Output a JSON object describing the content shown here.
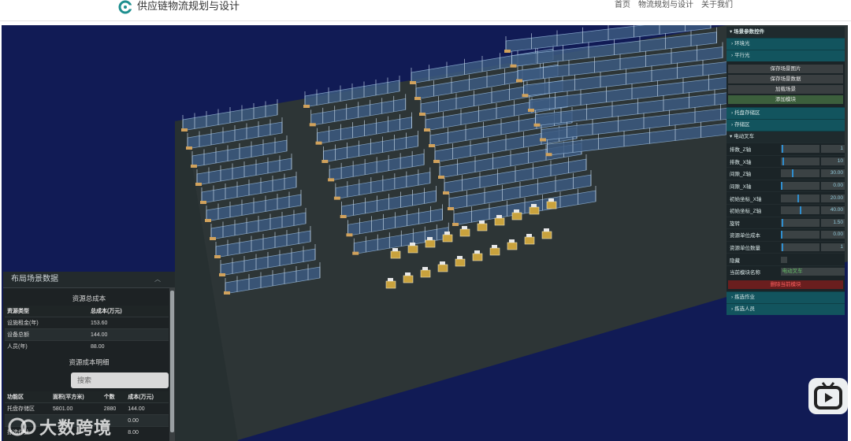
{
  "header": {
    "brand": "供应链物流规划与设计",
    "nav": [
      "首页",
      "物流规划与设计",
      "关于我们"
    ]
  },
  "control_panel": {
    "title": "场景参数控件",
    "top_sections": [
      "环境光",
      "平行光"
    ],
    "buttons": {
      "save_image": "保存场景图片",
      "save_data": "保存场景数据",
      "load_scene": "加载场景",
      "add_module": "添加模块"
    },
    "zones": [
      "托盘存储区",
      "存储区"
    ],
    "forklift": {
      "title": "电动叉车",
      "params": [
        {
          "label": "排数_Z轴",
          "value": "1",
          "level": 0.02
        },
        {
          "label": "排数_X轴",
          "value": "10",
          "level": 0.05
        },
        {
          "label": "间隙_Z轴",
          "value": "30.00",
          "level": 0.3
        },
        {
          "label": "间隙_X轴",
          "value": "0.00",
          "level": 0.0
        },
        {
          "label": "初始坐标_X轴",
          "value": "20.00",
          "level": 0.45
        },
        {
          "label": "初始坐标_Z轴",
          "value": "40.00",
          "level": 0.5
        },
        {
          "label": "旋转",
          "value": "1.50",
          "level": 0.02
        },
        {
          "label": "资源单位成本",
          "value": "0.00",
          "level": 0.0
        },
        {
          "label": "资源单位数量",
          "value": "1",
          "level": 0.02
        }
      ],
      "hidden_label": "隐藏",
      "module_name_label": "当前模块名称",
      "module_name_value": "电动叉车",
      "delete_label": "删除当前模块"
    },
    "bottom_sections": [
      "拣选作业",
      "拣选人员"
    ]
  },
  "data_panel": {
    "title": "布局场景数据",
    "total_cost_title": "资源总成本",
    "total_headers": [
      "资源类型",
      "总成本(万元)"
    ],
    "total_rows": [
      [
        "设施租金(年)",
        "153.60"
      ],
      [
        "设备总额",
        "144.00"
      ],
      [
        "人员(年)",
        "88.00"
      ]
    ],
    "detail_title": "资源成本明细",
    "search_placeholder": "搜索",
    "detail_headers": [
      "功能区",
      "面积(平方米)",
      "个数",
      "成本(万元)"
    ],
    "detail_rows": [
      [
        "托盘存储区",
        "5801.00",
        "2880",
        "144.00"
      ],
      [
        "",
        "",
        "",
        "0.00"
      ],
      [
        "拣选作业",
        "",
        "",
        "8.00"
      ]
    ]
  },
  "watermark": "大数跨境",
  "colors": {
    "scene_bg": "#111b55",
    "floor": "#2d3536",
    "panel_teal": "#12545e",
    "rack": "#8fb2d6",
    "pallet": "#d1a25c"
  }
}
